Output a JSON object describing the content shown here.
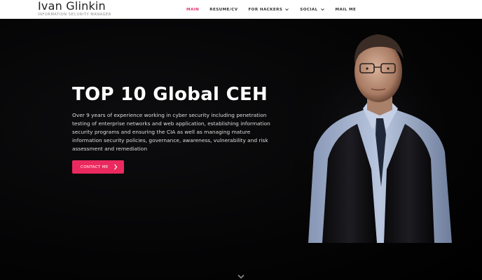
{
  "header": {
    "brand_name": "Ivan Glinkin",
    "brand_tagline": "INFORMATION SECURITY MANAGER",
    "nav": [
      {
        "label": "MAIN",
        "active": true,
        "dropdown": false
      },
      {
        "label": "RESUME/CV",
        "active": false,
        "dropdown": false
      },
      {
        "label": "FOR HACKERS",
        "active": false,
        "dropdown": true
      },
      {
        "label": "SOCIAL",
        "active": false,
        "dropdown": true
      },
      {
        "label": "MAIL ME",
        "active": false,
        "dropdown": false
      }
    ]
  },
  "hero": {
    "title": "TOP 10 Global CEH",
    "description": "Over 9 years of experience working in cyber security including penetration testing of enterprise networks and web application, establishing information security programs and ensuring the CIA as well as managing mature information security policies, governance, awareness, vulnerability and risk assessment and remediation",
    "cta_label": "CONTACT ME",
    "cta_icon": "chevron-right-icon",
    "scroll_icon": "chevron-down-icon"
  },
  "colors": {
    "accent": "#ea2a5f",
    "nav_active": "#e8336a",
    "header_bg": "#ffffff",
    "hero_bg": "#000000"
  }
}
